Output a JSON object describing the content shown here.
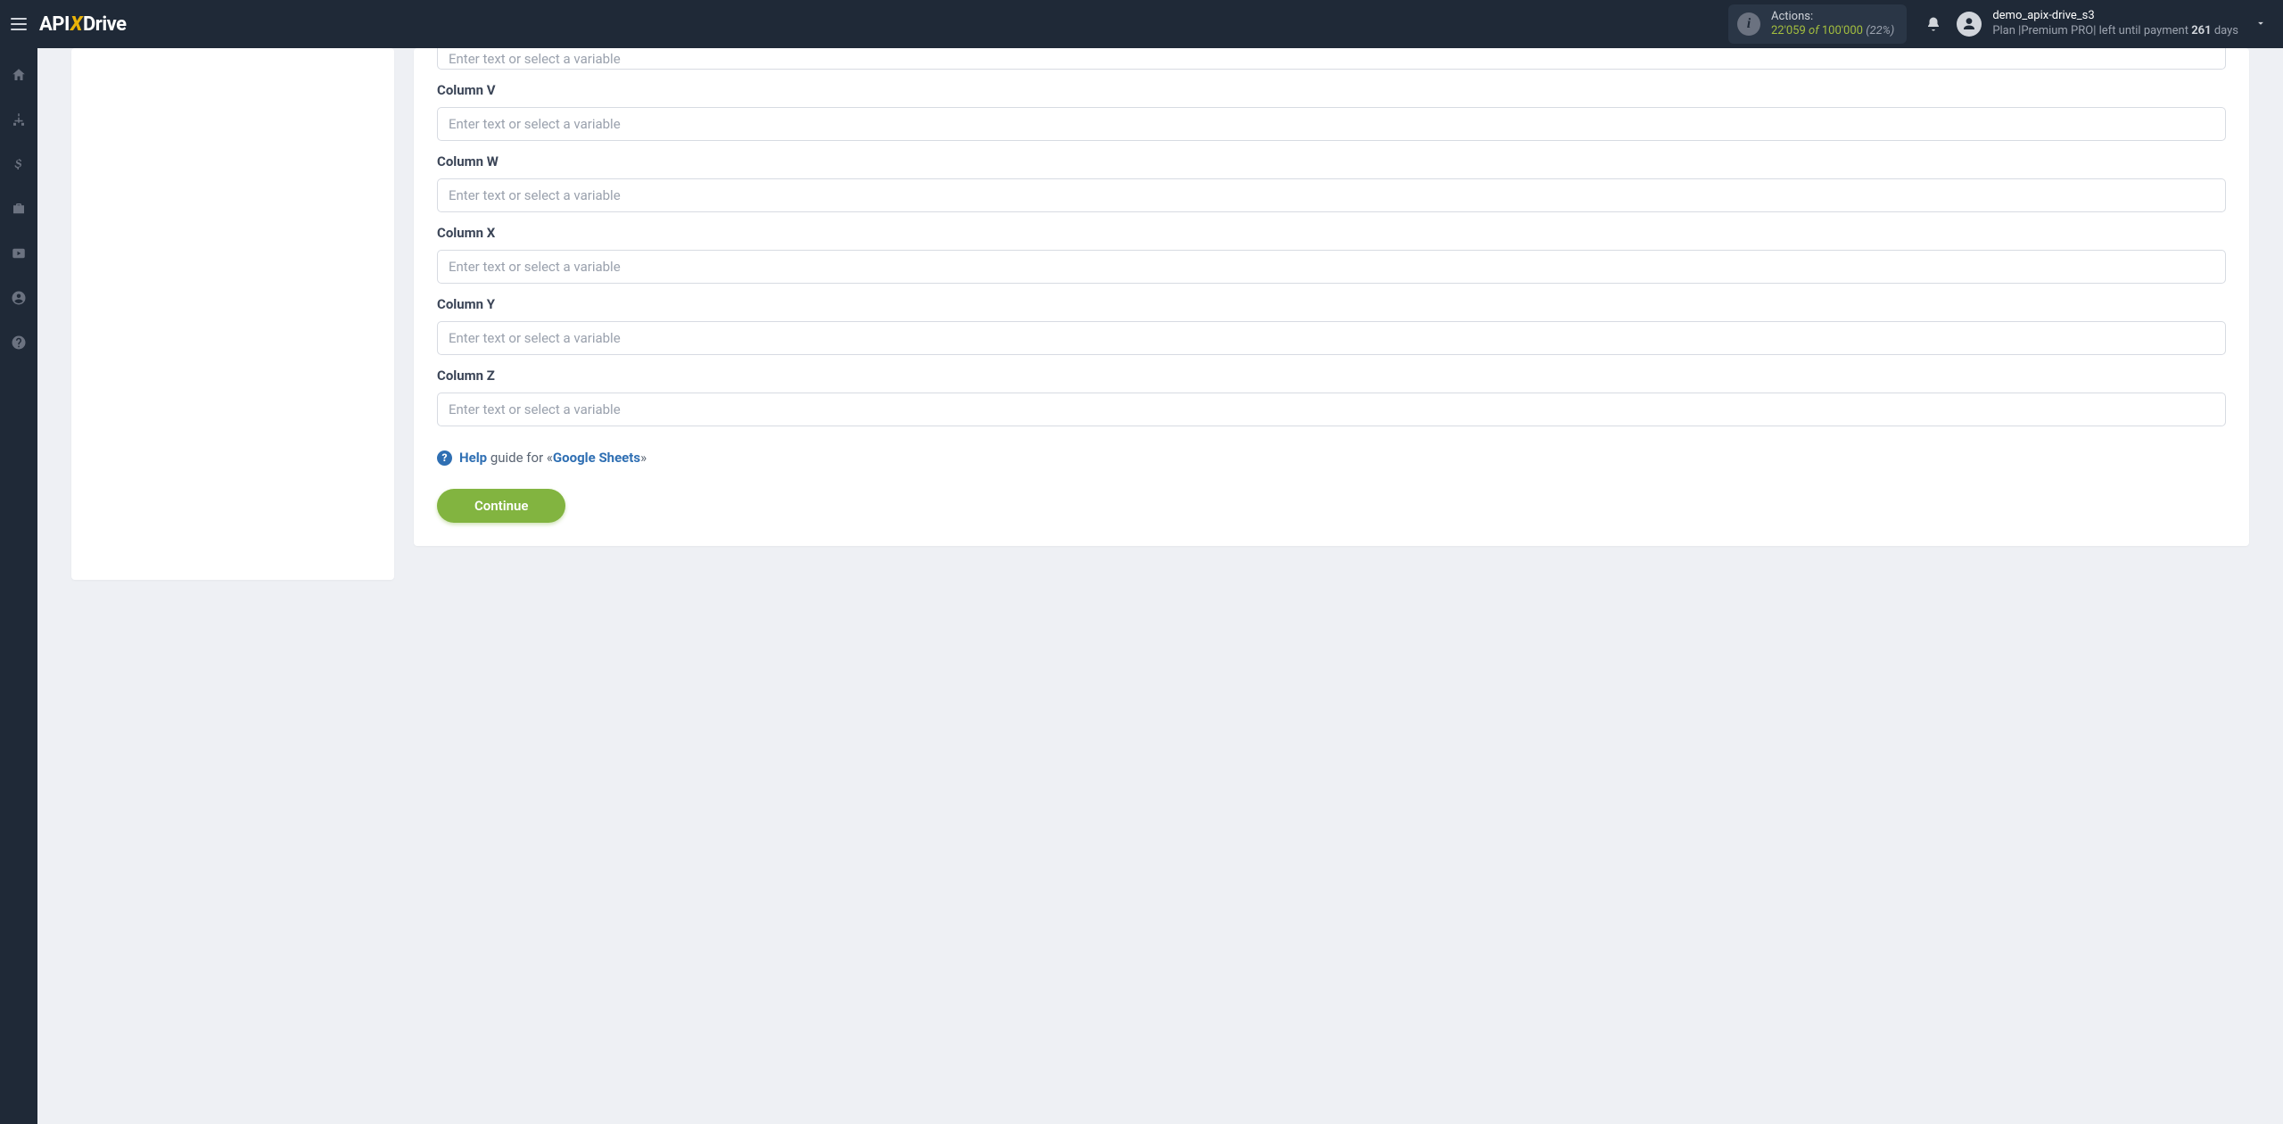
{
  "header": {
    "logo": {
      "part1": "API",
      "part2": "X",
      "part3": "Drive"
    },
    "actions": {
      "label": "Actions:",
      "used": "22'059",
      "of": "of",
      "total": "100'000",
      "percent": "(22%)"
    },
    "user": {
      "name": "demo_apix-drive_s3",
      "plan_prefix": "Plan |",
      "plan_name": "Premium PRO",
      "plan_mid": "| left until payment ",
      "days": "261",
      "days_suffix": " days"
    }
  },
  "form": {
    "placeholder": "Enter text or select a variable",
    "fields": [
      {
        "label": "Column V"
      },
      {
        "label": "Column W"
      },
      {
        "label": "Column X"
      },
      {
        "label": "Column Y"
      },
      {
        "label": "Column Z"
      }
    ]
  },
  "help": {
    "word": "Help",
    "mid": " guide for «",
    "target": "Google Sheets",
    "end": "»"
  },
  "buttons": {
    "continue": "Continue"
  },
  "sidebar_icons": [
    "home",
    "sitemap",
    "dollar",
    "briefcase",
    "youtube",
    "user",
    "help"
  ]
}
